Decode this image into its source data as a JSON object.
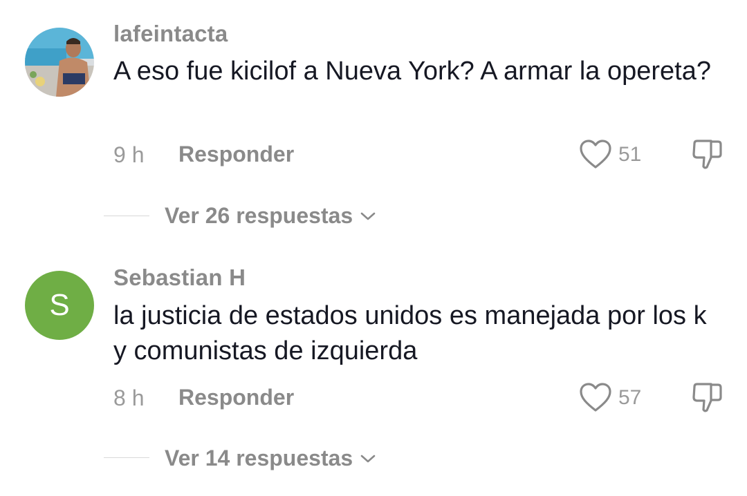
{
  "comments": [
    {
      "username": "lafeintacta",
      "avatar": "photo-avatar",
      "text": "A eso fue kicilof a Nueva York? A armar la opereta?",
      "time": "9 h",
      "reply_label": "Responder",
      "likes": "51",
      "view_replies": "Ver 26 respuestas"
    },
    {
      "username": "Sebastian H",
      "avatar_letter": "S",
      "avatar_color": "#6fae45",
      "text": "la justicia de estados unidos es manejada por los k y comunistas de izquierda",
      "time": "8 h",
      "reply_label": "Responder",
      "likes": "57",
      "view_replies": "Ver 14 respuestas"
    }
  ],
  "icons": {
    "like": "heart-outline-icon",
    "dislike": "thumbs-down-icon",
    "expand": "chevron-down-icon"
  }
}
